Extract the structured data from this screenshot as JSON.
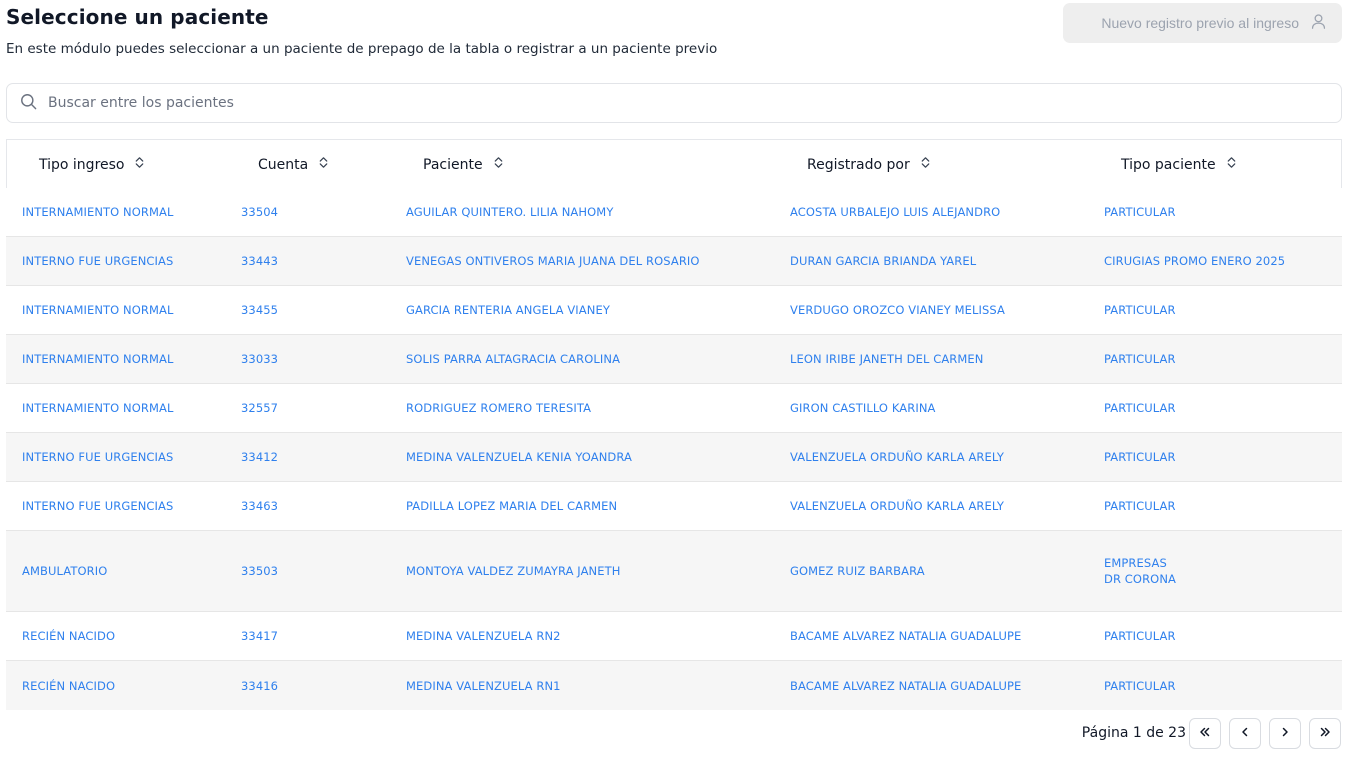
{
  "header": {
    "title": "Seleccione un paciente",
    "subtitle": "En este módulo puedes seleccionar a un paciente de prepago de la tabla o registrar a un paciente previo",
    "new_button_label": "Nuevo registro previo al ingreso",
    "new_button_icon": "user-icon"
  },
  "search": {
    "placeholder": "Buscar entre los pacientes",
    "value": ""
  },
  "table": {
    "columns": [
      "Tipo ingreso",
      "Cuenta",
      "Paciente",
      "Registrado por",
      "Tipo paciente"
    ],
    "rows": [
      {
        "tipo_ingreso": "INTERNAMIENTO NORMAL",
        "cuenta": "33504",
        "paciente": "AGUILAR QUINTERO. LILIA NAHOMY",
        "registrado_por": "ACOSTA URBALEJO LUIS ALEJANDRO",
        "tipo_paciente": "PARTICULAR",
        "tipo_paciente_2": ""
      },
      {
        "tipo_ingreso": "INTERNO FUE URGENCIAS",
        "cuenta": "33443",
        "paciente": "VENEGAS ONTIVEROS MARIA JUANA DEL ROSARIO",
        "registrado_por": "DURAN GARCIA BRIANDA YAREL",
        "tipo_paciente": "CIRUGIAS PROMO ENERO 2025",
        "tipo_paciente_2": ""
      },
      {
        "tipo_ingreso": "INTERNAMIENTO NORMAL",
        "cuenta": "33455",
        "paciente": "GARCIA RENTERIA ANGELA VIANEY",
        "registrado_por": "VERDUGO OROZCO VIANEY MELISSA",
        "tipo_paciente": "PARTICULAR",
        "tipo_paciente_2": ""
      },
      {
        "tipo_ingreso": "INTERNAMIENTO NORMAL",
        "cuenta": "33033",
        "paciente": "SOLIS PARRA ALTAGRACIA CAROLINA",
        "registrado_por": "LEON IRIBE JANETH DEL CARMEN",
        "tipo_paciente": "PARTICULAR",
        "tipo_paciente_2": ""
      },
      {
        "tipo_ingreso": "INTERNAMIENTO NORMAL",
        "cuenta": "32557",
        "paciente": "RODRIGUEZ ROMERO TERESITA",
        "registrado_por": "GIRON CASTILLO KARINA",
        "tipo_paciente": "PARTICULAR",
        "tipo_paciente_2": ""
      },
      {
        "tipo_ingreso": "INTERNO FUE URGENCIAS",
        "cuenta": "33412",
        "paciente": "MEDINA VALENZUELA KENIA YOANDRA",
        "registrado_por": "VALENZUELA ORDUÑO KARLA ARELY",
        "tipo_paciente": "PARTICULAR",
        "tipo_paciente_2": ""
      },
      {
        "tipo_ingreso": "INTERNO FUE URGENCIAS",
        "cuenta": "33463",
        "paciente": "PADILLA LOPEZ MARIA DEL CARMEN",
        "registrado_por": "VALENZUELA ORDUÑO KARLA ARELY",
        "tipo_paciente": "PARTICULAR",
        "tipo_paciente_2": ""
      },
      {
        "tipo_ingreso": "AMBULATORIO",
        "cuenta": "33503",
        "paciente": "MONTOYA VALDEZ ZUMAYRA JANETH",
        "registrado_por": "GOMEZ RUIZ BARBARA",
        "tipo_paciente": "EMPRESAS",
        "tipo_paciente_2": "DR CORONA"
      },
      {
        "tipo_ingreso": "RECIÉN NACIDO",
        "cuenta": "33417",
        "paciente": "MEDINA VALENZUELA RN2",
        "registrado_por": "BACAME ALVAREZ NATALIA GUADALUPE",
        "tipo_paciente": "PARTICULAR",
        "tipo_paciente_2": ""
      },
      {
        "tipo_ingreso": "RECIÉN NACIDO",
        "cuenta": "33416",
        "paciente": "MEDINA VALENZUELA RN1",
        "registrado_por": "BACAME ALVAREZ NATALIA GUADALUPE",
        "tipo_paciente": "PARTICULAR",
        "tipo_paciente_2": ""
      }
    ]
  },
  "pagination": {
    "label": "Página 1 de 23",
    "current_page": 1,
    "total_pages": 23
  },
  "colors": {
    "link": "#2f80ed",
    "row_alt": "#f6f6f6",
    "button_bg": "#eeeeee",
    "muted": "#9ca3af"
  }
}
